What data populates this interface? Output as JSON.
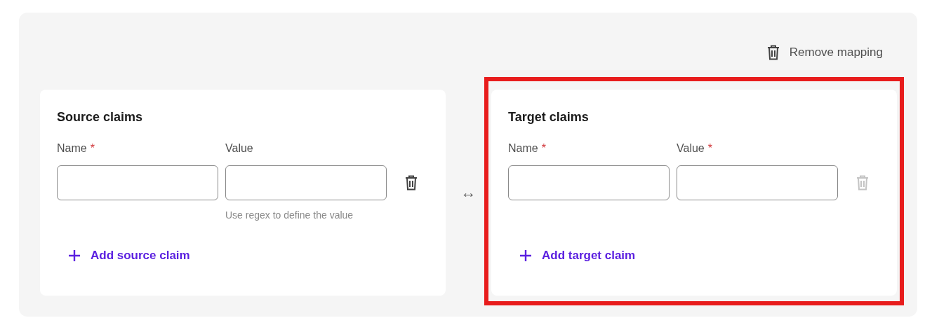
{
  "remove_mapping": {
    "label": "Remove mapping"
  },
  "mapping_symbol": "↔",
  "panels": [
    {
      "title": "Source claims",
      "highlighted": false,
      "delete_disabled": false,
      "add_label": "Add source claim",
      "fields": [
        {
          "label": "Name",
          "required_mark": "*"
        },
        {
          "label": "Value",
          "hint": "Use regex to define the value"
        }
      ]
    },
    {
      "title": "Target claims",
      "highlighted": true,
      "delete_disabled": true,
      "add_label": "Add target claim",
      "fields": [
        {
          "label": "Name",
          "required_mark": "*"
        },
        {
          "label": "Value",
          "required_mark": "*"
        }
      ]
    }
  ]
}
